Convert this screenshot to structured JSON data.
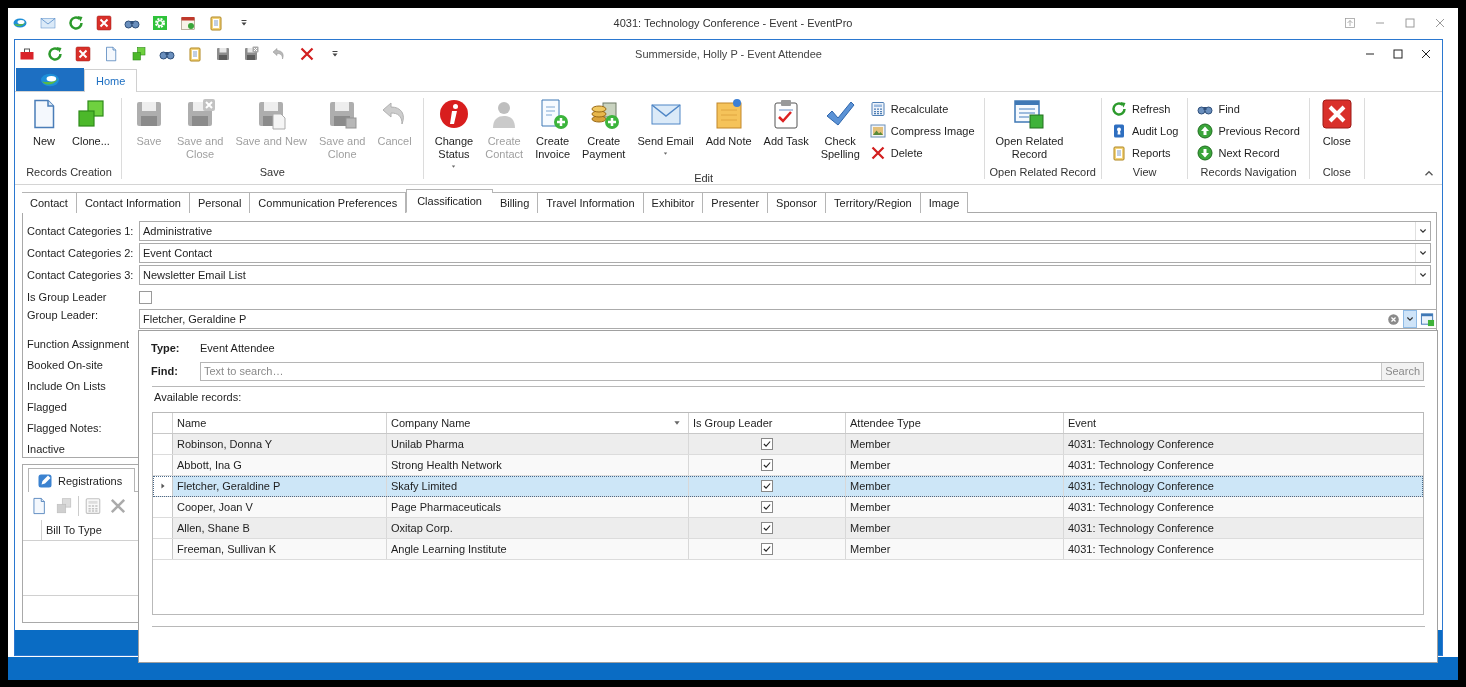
{
  "app_window": {
    "title": "4031: Technology Conference - Event - EventPro"
  },
  "record_window": {
    "title": "Summerside, Holly P - Event Attendee"
  },
  "ribbon": {
    "tabs": [
      {
        "label": "Home",
        "selected": true
      }
    ],
    "groups": [
      {
        "label": "Records Creation",
        "items": [
          {
            "label": "New",
            "kind": "large",
            "disabled": false,
            "dropdown": false
          },
          {
            "label": "Clone...",
            "kind": "large",
            "disabled": false,
            "dropdown": false
          }
        ]
      },
      {
        "label": "Save",
        "items": [
          {
            "label": "Save",
            "kind": "large",
            "disabled": true,
            "dropdown": false
          },
          {
            "label": "Save and\nClose",
            "kind": "large",
            "disabled": true,
            "dropdown": false
          },
          {
            "label": "Save and New",
            "kind": "large",
            "disabled": true,
            "dropdown": false
          },
          {
            "label": "Save and\nClone",
            "kind": "large",
            "disabled": true,
            "dropdown": false
          },
          {
            "label": "Cancel",
            "kind": "large",
            "disabled": true,
            "dropdown": false
          }
        ]
      },
      {
        "label": "Edit",
        "items": [
          {
            "label": "Change\nStatus",
            "kind": "large",
            "disabled": false,
            "dropdown": true
          },
          {
            "label": "Create\nContact",
            "kind": "large",
            "disabled": true,
            "dropdown": false
          },
          {
            "label": "Create\nInvoice",
            "kind": "large",
            "disabled": false,
            "dropdown": false
          },
          {
            "label": "Create\nPayment",
            "kind": "large",
            "disabled": false,
            "dropdown": false
          },
          {
            "label": "Send Email",
            "kind": "large",
            "disabled": false,
            "dropdown": true
          },
          {
            "label": "Add Note",
            "kind": "large",
            "disabled": false,
            "dropdown": false
          },
          {
            "label": "Add Task",
            "kind": "large",
            "disabled": false,
            "dropdown": false
          },
          {
            "label": "Check\nSpelling",
            "kind": "large",
            "disabled": false,
            "dropdown": false
          },
          {
            "label": "Recalculate",
            "kind": "small",
            "disabled": false,
            "dropdown": false
          },
          {
            "label": "Compress Image",
            "kind": "small",
            "disabled": false,
            "dropdown": false
          },
          {
            "label": "Delete",
            "kind": "small",
            "disabled": false,
            "dropdown": false
          }
        ]
      },
      {
        "label": "Open Related Record",
        "items": [
          {
            "label": "Open Related\nRecord",
            "kind": "large",
            "disabled": false,
            "dropdown": false
          }
        ]
      },
      {
        "label": "View",
        "items": [
          {
            "label": "Refresh",
            "kind": "small",
            "disabled": false,
            "dropdown": false
          },
          {
            "label": "Audit Log",
            "kind": "small",
            "disabled": false,
            "dropdown": false
          },
          {
            "label": "Reports",
            "kind": "small",
            "disabled": false,
            "dropdown": false
          }
        ]
      },
      {
        "label": "Records Navigation",
        "items": [
          {
            "label": "Find",
            "kind": "small",
            "disabled": false,
            "dropdown": false
          },
          {
            "label": "Previous Record",
            "kind": "small",
            "disabled": false,
            "dropdown": false
          },
          {
            "label": "Next Record",
            "kind": "small",
            "disabled": false,
            "dropdown": false
          }
        ]
      },
      {
        "label": "Close",
        "items": [
          {
            "label": "Close",
            "kind": "large",
            "disabled": false,
            "dropdown": false
          }
        ]
      }
    ]
  },
  "record_tabs": [
    {
      "label": "Contact",
      "selected": false
    },
    {
      "label": "Contact Information",
      "selected": false
    },
    {
      "label": "Personal",
      "selected": false
    },
    {
      "label": "Communication Preferences",
      "selected": false
    },
    {
      "label": "Classification",
      "selected": true
    },
    {
      "label": "Billing",
      "selected": false
    },
    {
      "label": "Travel Information",
      "selected": false
    },
    {
      "label": "Exhibitor",
      "selected": false
    },
    {
      "label": "Presenter",
      "selected": false
    },
    {
      "label": "Sponsor",
      "selected": false
    },
    {
      "label": "Territory/Region",
      "selected": false
    },
    {
      "label": "Image",
      "selected": false
    }
  ],
  "form": {
    "fields": [
      {
        "label": "Contact Categories 1:",
        "kind": "combo",
        "value": "Administrative"
      },
      {
        "label": "Contact Categories 2:",
        "kind": "combo",
        "value": "Event Contact"
      },
      {
        "label": "Contact Categories 3:",
        "kind": "combo",
        "value": "Newsletter Email List"
      },
      {
        "label": "Is Group Leader",
        "kind": "checkbox",
        "checked": false
      },
      {
        "label": "Group Leader:",
        "kind": "lookup",
        "value": "Fletcher, Geraldine P"
      },
      {
        "label": "Function Assignment",
        "kind": "label_only"
      },
      {
        "label": "Booked On-site",
        "kind": "label_only"
      },
      {
        "label": "Include On Lists",
        "kind": "label_only"
      },
      {
        "label": "Flagged",
        "kind": "label_only"
      },
      {
        "label": "Flagged Notes:",
        "kind": "label_only"
      },
      {
        "label": "Inactive",
        "kind": "label_only"
      }
    ]
  },
  "subpanel": {
    "tabs": [
      {
        "label": "Registrations",
        "selected": true
      }
    ],
    "toolbar": [
      {
        "disabled": false
      },
      {
        "disabled": true
      },
      {
        "disabled": true
      },
      {
        "disabled": true
      }
    ],
    "columns": [
      "Bill To Type"
    ]
  },
  "lookup": {
    "type_label": "Type:",
    "type_value": "Event Attendee",
    "find_label": "Find:",
    "find_placeholder": "Text to search…",
    "search_button": "Search",
    "records_label": "Available records:",
    "columns": [
      {
        "label": "Name",
        "filter": false
      },
      {
        "label": "Company Name",
        "filter": true
      },
      {
        "label": "Is Group Leader",
        "filter": false
      },
      {
        "label": "Attendee Type",
        "filter": false
      },
      {
        "label": "Event",
        "filter": false
      }
    ],
    "rows": [
      {
        "name": "Robinson, Donna Y",
        "company": "Unilab Pharma",
        "is_group_leader": true,
        "attendee_type": "Member",
        "event": "4031: Technology Conference",
        "selected": false
      },
      {
        "name": "Abbott, Ina G",
        "company": "Strong Health Network",
        "is_group_leader": true,
        "attendee_type": "Member",
        "event": "4031: Technology Conference",
        "selected": false
      },
      {
        "name": "Fletcher, Geraldine P",
        "company": "Skafy Limited",
        "is_group_leader": true,
        "attendee_type": "Member",
        "event": "4031: Technology Conference",
        "selected": true
      },
      {
        "name": "Cooper, Joan V",
        "company": "Page Pharmaceuticals",
        "is_group_leader": true,
        "attendee_type": "Member",
        "event": "4031: Technology Conference",
        "selected": false
      },
      {
        "name": "Allen, Shane B",
        "company": "Oxitap Corp.",
        "is_group_leader": true,
        "attendee_type": "Member",
        "event": "4031: Technology Conference",
        "selected": false
      },
      {
        "name": "Freeman, Sullivan K",
        "company": "Angle Learning Institute",
        "is_group_leader": true,
        "attendee_type": "Member",
        "event": "4031: Technology Conference",
        "selected": false
      }
    ]
  }
}
